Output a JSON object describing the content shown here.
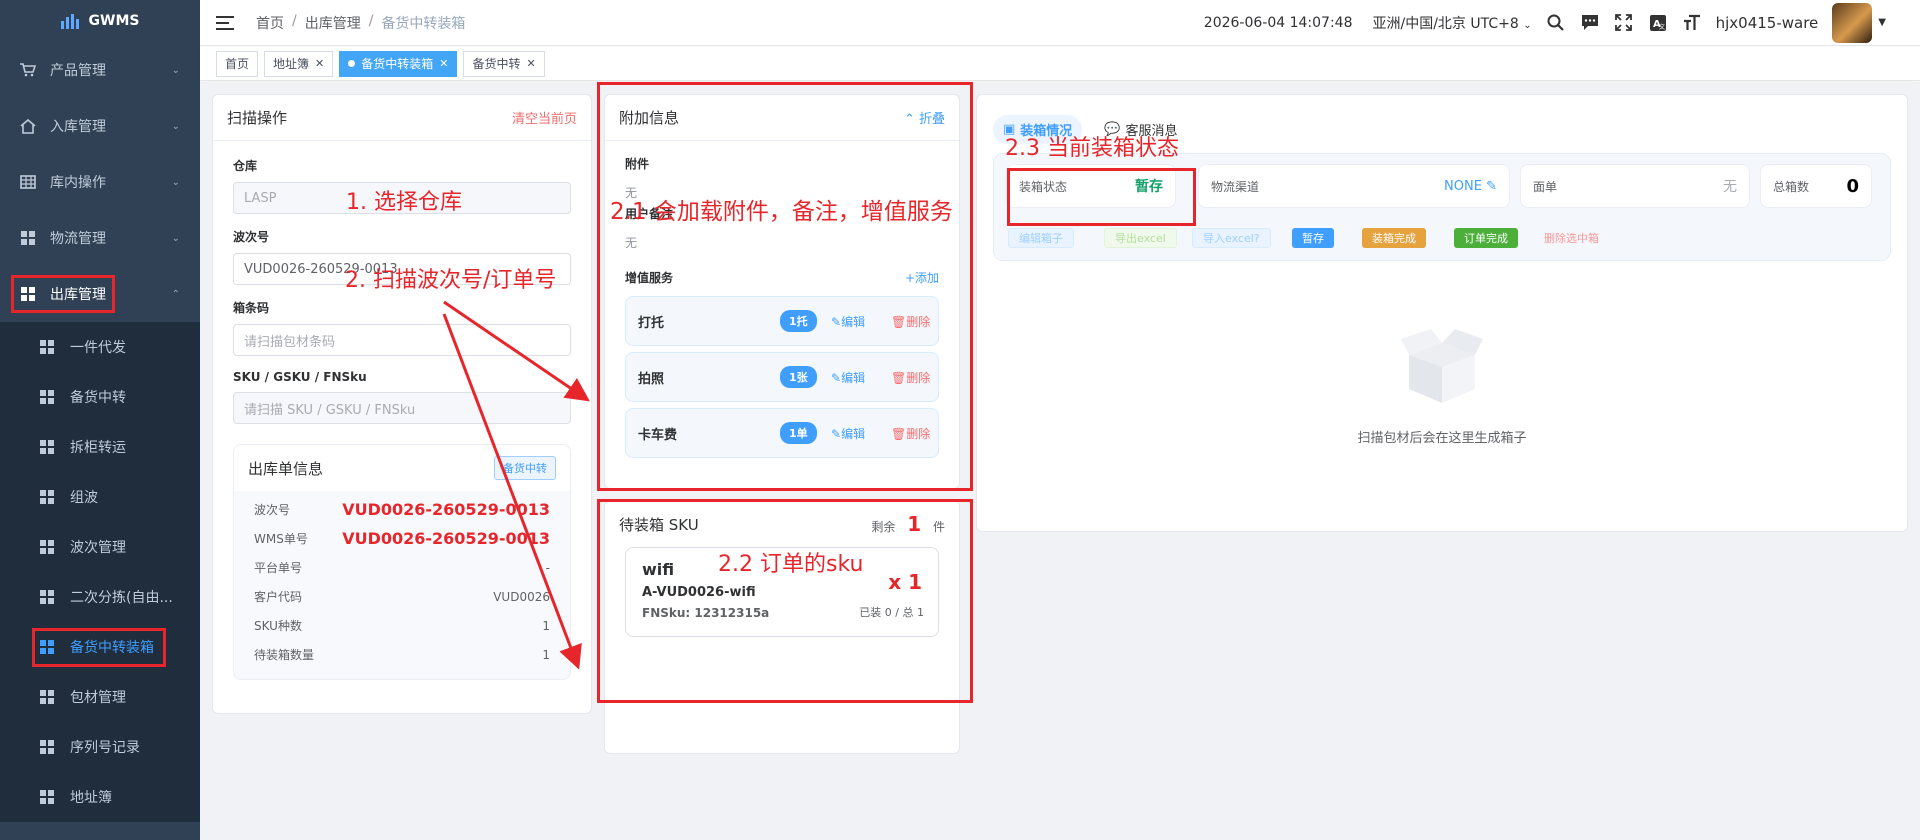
{
  "app": {
    "name": "GWMS"
  },
  "sidebar": {
    "items": [
      {
        "label": "产品管理"
      },
      {
        "label": "入库管理"
      },
      {
        "label": "库内操作"
      },
      {
        "label": "物流管理"
      },
      {
        "label": "出库管理"
      }
    ],
    "subitems": [
      {
        "label": "一件代发"
      },
      {
        "label": "备货中转"
      },
      {
        "label": "拆柜转运"
      },
      {
        "label": "组波"
      },
      {
        "label": "波次管理"
      },
      {
        "label": "二次分拣(自由..."
      },
      {
        "label": "备货中转装箱"
      },
      {
        "label": "包材管理"
      },
      {
        "label": "序列号记录"
      },
      {
        "label": "地址簿"
      }
    ]
  },
  "header": {
    "breadcrumb": [
      "首页",
      "出库管理",
      "备货中转装箱"
    ],
    "datetime": "2026-06-04 14:07:48",
    "timezone": "亚洲/中国/北京 UTC+8",
    "username": "hjx0415-ware"
  },
  "tags": [
    {
      "label": "首页"
    },
    {
      "label": "地址簿"
    },
    {
      "label": "备货中转装箱"
    },
    {
      "label": "备货中转"
    }
  ],
  "scan": {
    "title": "扫描操作",
    "clear": "清空当前页",
    "warehouse_label": "仓库",
    "warehouse_value": "LASP",
    "wave_label": "波次号",
    "wave_value": "VUD0026-260529-0013",
    "box_label": "箱条码",
    "box_placeholder": "请扫描包材条码",
    "sku_label": "SKU / GSKU / FNSku",
    "sku_placeholder": "请扫描 SKU / GSKU / FNSku"
  },
  "order_info": {
    "title": "出库单信息",
    "button": "备货中转",
    "rows": [
      {
        "label": "波次号",
        "value": "VUD0026-260529-0013"
      },
      {
        "label": "WMS单号",
        "value": "VUD0026-260529-0013"
      },
      {
        "label": "平台单号",
        "value": "-"
      },
      {
        "label": "客户代码",
        "value": "VUD0026"
      },
      {
        "label": "SKU种数",
        "value": "1"
      },
      {
        "label": "待装箱数量",
        "value": "1"
      }
    ]
  },
  "extra": {
    "title": "附加信息",
    "collapse": "折叠",
    "attach_label": "附件",
    "attach_value": "无",
    "remark_label": "用户备注",
    "remark_value": "无",
    "vas_label": "增值服务",
    "vas_add": "+添加",
    "edit": "编辑",
    "delete": "删除",
    "services": [
      {
        "name": "打托",
        "badge": "1托"
      },
      {
        "name": "拍照",
        "badge": "1张"
      },
      {
        "name": "卡车费",
        "badge": "1单"
      }
    ]
  },
  "pending": {
    "title": "待装箱 SKU",
    "remain_label": "剩余",
    "remain_value": "1",
    "remain_unit": "件",
    "sku": {
      "name": "wifi",
      "code": "A-VUD0026-wifi",
      "fnsku": "FNSku: 12312315a",
      "qty": "x 1",
      "progress": "已装 0 / 总 1"
    }
  },
  "boxing": {
    "tab_status": "装箱情况",
    "tab_service": "客服消息",
    "status_label": "装箱状态",
    "status_value": "暂存",
    "channel_label": "物流渠道",
    "channel_value": "NONE",
    "sheet_label": "面单",
    "sheet_value": "无",
    "total_label": "总箱数",
    "total_value": "0",
    "buttons": {
      "edit": "编辑箱子",
      "export": "导出excel",
      "import": "导入excel?",
      "save": "暂存",
      "complete": "装箱完成",
      "order_complete": "订单完成",
      "delete": "删除选中箱"
    },
    "empty_text": "扫描包材后会在这里生成箱子"
  },
  "annotations": {
    "a1": "1. 选择仓库",
    "a2": "2. 扫描波次号/订单号",
    "a21": "2.1 会加载附件，备注，增值服务",
    "a22": "2.2 订单的sku",
    "a23": "2.3 当前装箱状态"
  },
  "colors": {
    "accent": "#409eff",
    "annotation": "#e7262b",
    "sidebar": "#304156"
  }
}
